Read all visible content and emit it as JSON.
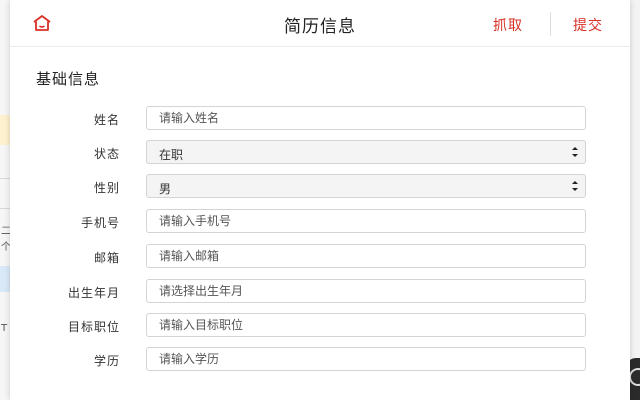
{
  "header": {
    "title": "简历信息",
    "grab_label": "抓取",
    "submit_label": "提交",
    "home_icon": "home-icon",
    "accent_color": "#d93025"
  },
  "section": {
    "title": "基础信息"
  },
  "form": {
    "fields": [
      {
        "label": "姓名",
        "type": "text",
        "value": "",
        "placeholder": "请输入姓名"
      },
      {
        "label": "状态",
        "type": "select",
        "value": "在职"
      },
      {
        "label": "性别",
        "type": "select",
        "value": "男"
      },
      {
        "label": "手机号",
        "type": "text",
        "value": "",
        "placeholder": "请输入手机号"
      },
      {
        "label": "邮箱",
        "type": "text",
        "value": "",
        "placeholder": "请输入邮箱"
      },
      {
        "label": "出生年月",
        "type": "text",
        "value": "",
        "placeholder": "请选择出生年月"
      },
      {
        "label": "目标职位",
        "type": "text",
        "value": "",
        "placeholder": "请输入目标职位"
      },
      {
        "label": "学历",
        "type": "text",
        "value": "",
        "placeholder": "请输入学历"
      }
    ]
  },
  "background": {
    "left_texts": [
      "二",
      "个",
      "T"
    ]
  }
}
